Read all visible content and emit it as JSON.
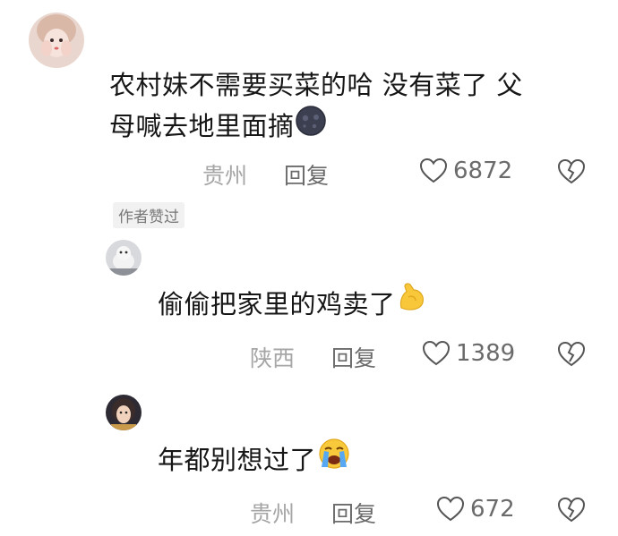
{
  "comments": [
    {
      "text_line1": "农村妹不需要买菜的哈 没有菜了 父",
      "text_line2": "母喊去地里面摘",
      "emoji": "new-moon-face-emoji",
      "location": "贵州",
      "reply_label": "回复",
      "like_count": "6872"
    },
    {
      "badge": "作者赞过",
      "text": "偷偷把家里的鸡卖了",
      "emoji": "flexed-biceps-emoji",
      "location": "陕西",
      "reply_label": "回复",
      "like_count": "1389"
    },
    {
      "text": "年都别想过了",
      "emoji": "loudly-crying-face-emoji",
      "location": "贵州",
      "reply_label": "回复",
      "like_count": "672"
    }
  ],
  "colors": {
    "text": "#161616",
    "meta": "#a6a6a6",
    "action": "#6b6b6b",
    "badge_bg": "#f1f1f1"
  }
}
